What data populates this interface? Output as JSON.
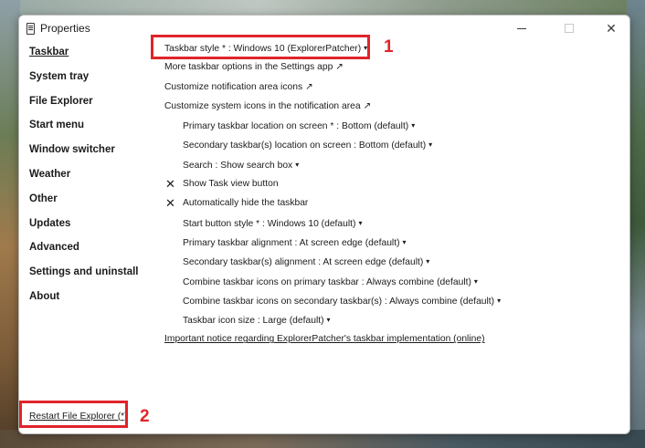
{
  "window": {
    "title": "Properties"
  },
  "sidebar": {
    "items": [
      {
        "label": "Taskbar",
        "active": true
      },
      {
        "label": "System tray"
      },
      {
        "label": "File Explorer"
      },
      {
        "label": "Start menu"
      },
      {
        "label": "Window switcher"
      },
      {
        "label": "Weather"
      },
      {
        "label": "Other"
      },
      {
        "label": "Updates"
      },
      {
        "label": "Advanced"
      },
      {
        "label": "Settings and uninstall"
      },
      {
        "label": "About"
      }
    ],
    "restart_label": "Restart File Explorer (*)"
  },
  "settings": {
    "taskbar_style": "Taskbar style * : Windows 10 (ExplorerPatcher)",
    "more_options": "More taskbar options in the Settings app ↗",
    "notif_icons": "Customize notification area icons ↗",
    "system_icons": "Customize system icons in the notification area ↗",
    "primary_location": "Primary taskbar location on screen * : Bottom (default)",
    "secondary_location": "Secondary taskbar(s) location on screen : Bottom (default)",
    "search": "Search : Show search box",
    "task_view": "Show Task view button",
    "auto_hide": "Automatically hide the taskbar",
    "start_style": "Start button style * : Windows 10 (default)",
    "primary_alignment": "Primary taskbar alignment : At screen edge (default)",
    "secondary_alignment": "Secondary taskbar(s) alignment : At screen edge (default)",
    "combine_primary": "Combine taskbar icons on primary taskbar : Always combine (default)",
    "combine_secondary": "Combine taskbar icons on secondary taskbar(s) : Always combine (default)",
    "icon_size": "Taskbar icon size : Large (default)",
    "notice": "Important notice regarding ExplorerPatcher's taskbar implementation (online)"
  },
  "markers": {
    "one": "1",
    "two": "2"
  },
  "icons": {
    "dropdown": "▾",
    "checked": "✕",
    "close": "✕"
  },
  "colors": {
    "highlight": "#e0242b"
  }
}
